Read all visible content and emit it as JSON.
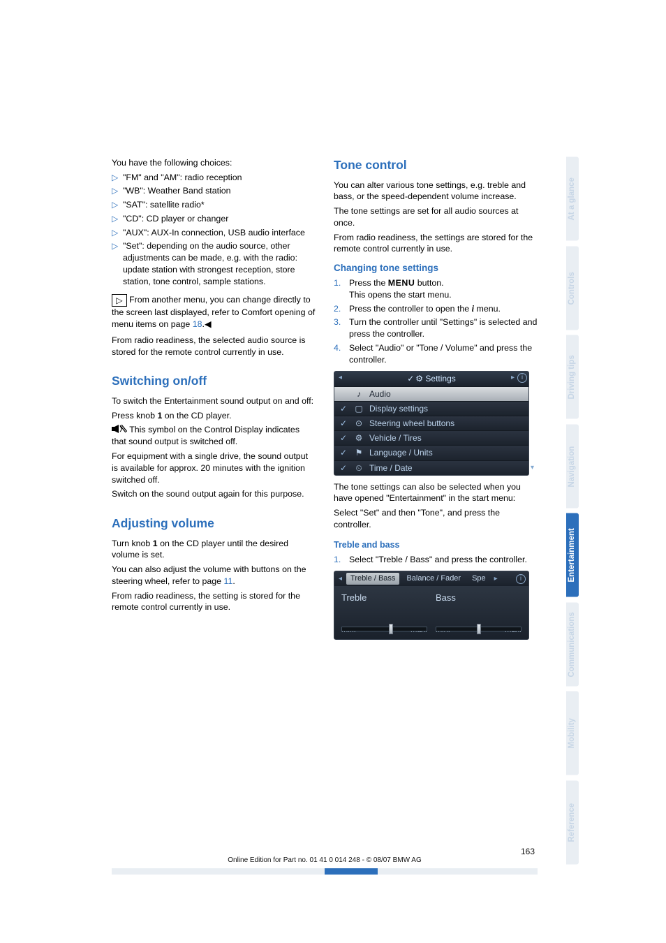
{
  "left": {
    "choices_intro": "You have the following choices:",
    "bullets": [
      "\"FM\" and \"AM\": radio reception",
      "\"WB\": Weather Band station",
      "\"SAT\": satellite radio*",
      "\"CD\": CD player or changer",
      "\"AUX\": AUX-In connection, USB audio interface",
      "\"Set\": depending on the audio source, other adjustments can be made, e.g. with the radio: update station with strongest reception, store station, tone control, sample stations."
    ],
    "note_pre": "From another menu, you can change directly to the screen last displayed, refer to Comfort opening of menu items on page ",
    "note_link": "18",
    "note_post": ".◀",
    "after_note": "From radio readiness, the selected audio source is stored for the remote control currently in use.",
    "switching_head": "Switching on/off",
    "switching_p1": "To switch the Entertainment sound output on and off:",
    "switching_p2a": "Press knob ",
    "switching_p2b": "1",
    "switching_p2c": " on the CD player.",
    "switching_mute": " This symbol on the Control Display indicates that sound output is switched off.",
    "switching_p3": "For equipment with a single drive, the sound output is available for approx. 20 minutes with the ignition switched off.",
    "switching_p4": "Switch on the sound output again for this purpose.",
    "adjvol_head": "Adjusting volume",
    "adjvol_p1a": "Turn knob ",
    "adjvol_p1b": "1",
    "adjvol_p1c": " on the CD player until the desired volume is set.",
    "adjvol_p2a": "You can also adjust the volume with buttons on the steering wheel, refer to page ",
    "adjvol_p2link": "11",
    "adjvol_p2b": ".",
    "adjvol_p3": "From radio readiness, the setting is stored for the remote control currently in use."
  },
  "right": {
    "tone_head": "Tone control",
    "tone_p1": "You can alter various tone settings, e.g. treble and bass, or the speed-dependent volume increase.",
    "tone_p2": "The tone settings are set for all audio sources at once.",
    "tone_p3": "From radio readiness, the settings are stored for the remote control currently in use.",
    "chg_head": "Changing tone settings",
    "steps": [
      {
        "n": "1.",
        "pre": "Press the ",
        "menu": "MENU",
        "post": " button.",
        "line2": "This opens the start menu."
      },
      {
        "n": "2.",
        "pre": "Press the controller to open the ",
        "info": "i",
        "post": " menu."
      },
      {
        "n": "3.",
        "text": "Turn the controller until \"Settings\" is selected and press the controller."
      },
      {
        "n": "4.",
        "text": "Select \"Audio\" or \"Tone / Volume\" and press the controller."
      }
    ],
    "shot1": {
      "title": "Settings",
      "rows": [
        {
          "sel": true,
          "chk": "",
          "icon": "♪",
          "label": "Audio"
        },
        {
          "sel": false,
          "chk": "✓",
          "icon": "▢",
          "label": "Display settings"
        },
        {
          "sel": false,
          "chk": "✓",
          "icon": "⊙",
          "label": "Steering wheel buttons"
        },
        {
          "sel": false,
          "chk": "✓",
          "icon": "⚙",
          "label": "Vehicle / Tires"
        },
        {
          "sel": false,
          "chk": "✓",
          "icon": "⚑",
          "label": "Language / Units"
        },
        {
          "sel": false,
          "chk": "✓",
          "icon": "⏲",
          "label": "Time / Date"
        }
      ]
    },
    "after_shot1a": "The tone settings can also be selected when you have opened \"Entertainment\" in the start menu:",
    "after_shot1b": "Select \"Set\" and then \"Tone\", and press the controller.",
    "tb_head": "Treble and bass",
    "tb_step": {
      "n": "1.",
      "text": "Select \"Treble / Bass\" and press the controller."
    },
    "shot2": {
      "tab_active": "Treble / Bass",
      "tab2": "Balance / Fader",
      "tab3": "Spe",
      "treble": "Treble",
      "bass": "Bass",
      "min": "min.",
      "max": "max."
    }
  },
  "side_tabs": [
    "At a glance",
    "Controls",
    "Driving tips",
    "Navigation",
    "Entertainment",
    "Communications",
    "Mobility",
    "Reference"
  ],
  "side_active_index": 4,
  "footer": {
    "page": "163",
    "line": "Online Edition for Part no. 01 41 0 014 248 - © 08/07 BMW AG"
  }
}
